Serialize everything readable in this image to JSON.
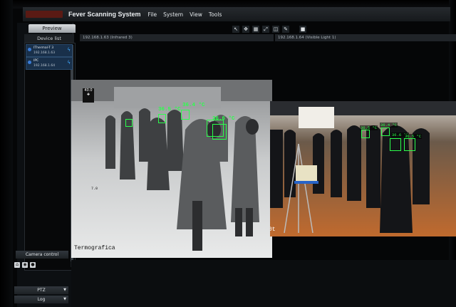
{
  "app": {
    "title": "Fever Scanning System",
    "menu": [
      "File",
      "System",
      "View",
      "Tools"
    ]
  },
  "left_panel": {
    "preview_tab": "Preview",
    "device_list_title": "Device list",
    "devices": [
      {
        "name": "IThermal-T 3",
        "ip": "192.168.1.63"
      },
      {
        "name": "IPC",
        "ip": "192.168.1.64"
      }
    ],
    "sections": {
      "camera_control": "Camera control",
      "ptz": "PTZ",
      "log": "Log"
    }
  },
  "channels": {
    "infrared": "192.168.1.63 (Infrared 3)",
    "visible": "192.168.1.64 (Visible Light 1)"
  },
  "thermal": {
    "scale_top": "40.0",
    "scale_mid": "7.0",
    "watermark": "Termografica",
    "temps": [
      "36.5 °C",
      "36.4 °C",
      "36.6 °C"
    ]
  },
  "visible": {
    "corner_text": "0t",
    "temps": [
      "36.5 °C",
      "36.4 °C",
      "36.6 °C",
      "36.5 °C"
    ]
  },
  "colors": {
    "detection": "#2bff4c",
    "device_selected": "#19304a",
    "status_icon": "#3fa9ff"
  }
}
